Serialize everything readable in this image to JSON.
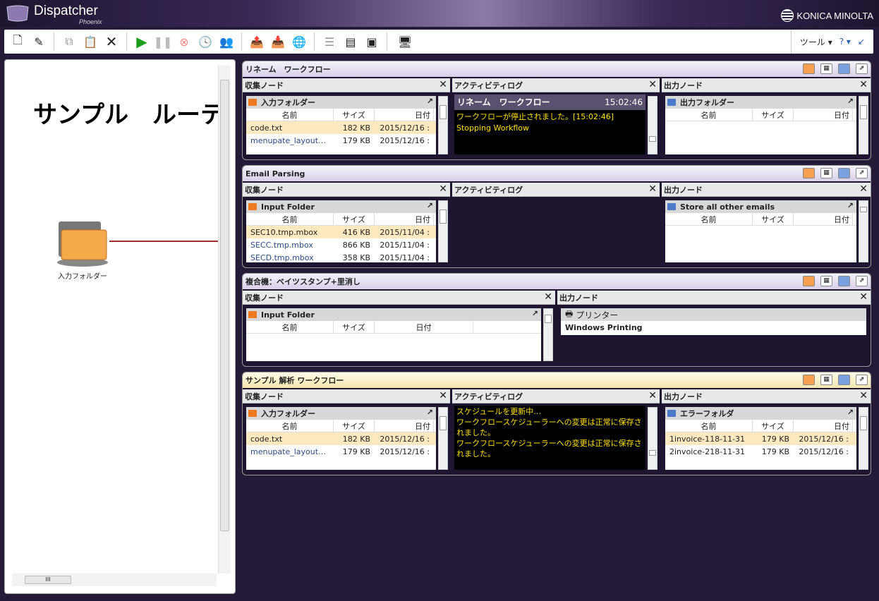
{
  "app": {
    "name": "Dispatcher",
    "sub": "Phoenix",
    "brand": "KONICA MINOLTA"
  },
  "toolbar": {
    "tools_label": "ツール ▾",
    "help_label": "? ▾"
  },
  "canvas": {
    "title": "サンプル　ルーテ",
    "node_label": "入力フォルダー",
    "hscroll_label": "III"
  },
  "panels": [
    {
      "title": "リネーム　ワークフロー",
      "collect": {
        "header": "収集ノード",
        "folder": "入力フォルダー",
        "cols": [
          "名前",
          "サイズ",
          "日付"
        ],
        "rows": [
          [
            "code.txt",
            "182 KB",
            "2015/12/16 :"
          ],
          [
            "menupate_layout…",
            "179 KB",
            "2015/12/16 :"
          ]
        ]
      },
      "activity": {
        "header": "アクティビティログ",
        "log_title": "リネーム　ワークフロー",
        "log_time": "15:02:46",
        "lines": [
          "ワークフローが停止されました。[15:02:46]",
          "Stopping Workflow"
        ]
      },
      "output": {
        "header": "出力ノード",
        "folder": "出力フォルダー",
        "cols": [
          "名前",
          "サイズ",
          "日付"
        ],
        "rows": []
      }
    },
    {
      "title": "Email Parsing",
      "collect": {
        "header": "収集ノード",
        "folder": "Input Folder",
        "cols": [
          "名前",
          "サイズ",
          "日付"
        ],
        "rows": [
          [
            "SEC10.tmp.mbox",
            "416 KB",
            "2015/11/04 :"
          ],
          [
            "SECC.tmp.mbox",
            "866 KB",
            "2015/11/04 :"
          ],
          [
            "SECD.tmp.mbox",
            "358 KB",
            "2015/11/04 :"
          ]
        ]
      },
      "activity": {
        "header": "アクティビティログ"
      },
      "output": {
        "header": "出力ノード",
        "folder": "Store all other emails",
        "cols": [
          "名前",
          "サイズ",
          "日付"
        ],
        "rows": []
      }
    },
    {
      "title": "複合機：ベイツスタンプ+里消し",
      "collect": {
        "header": "収集ノード",
        "folder": "Input Folder",
        "cols": [
          "名前",
          "サイズ",
          "日付"
        ],
        "rows": []
      },
      "output": {
        "header": "出力ノード",
        "printer_label": "プリンター",
        "printer_value": "Windows Printing"
      }
    },
    {
      "title": "サンプル 解析 ワークフロー",
      "collect": {
        "header": "収集ノード",
        "folder": "入力フォルダー",
        "cols": [
          "名前",
          "サイズ",
          "日付"
        ],
        "rows": [
          [
            "code.txt",
            "182 KB",
            "2015/12/16 :"
          ],
          [
            "menupate_layout…",
            "179 KB",
            "2015/12/16 :"
          ]
        ]
      },
      "activity": {
        "header": "アクティビティログ",
        "lines": [
          "スケジュールを更新中…",
          "ワークフロースケジューラーへの変更は正常に保存さ",
          "れました。",
          "ワークフロースケジューラーへの変更は正常に保存さ",
          "れました。"
        ]
      },
      "output": {
        "header": "出力ノード",
        "folder": "エラーフォルダ",
        "cols": [
          "名前",
          "サイズ",
          "日付"
        ],
        "rows": [
          [
            "1invoice-118-11-31",
            "179 KB",
            "2015/12/16 :"
          ],
          [
            "2invoice-218-11-31",
            "179 KB",
            "2015/12/16 :"
          ]
        ]
      }
    }
  ]
}
